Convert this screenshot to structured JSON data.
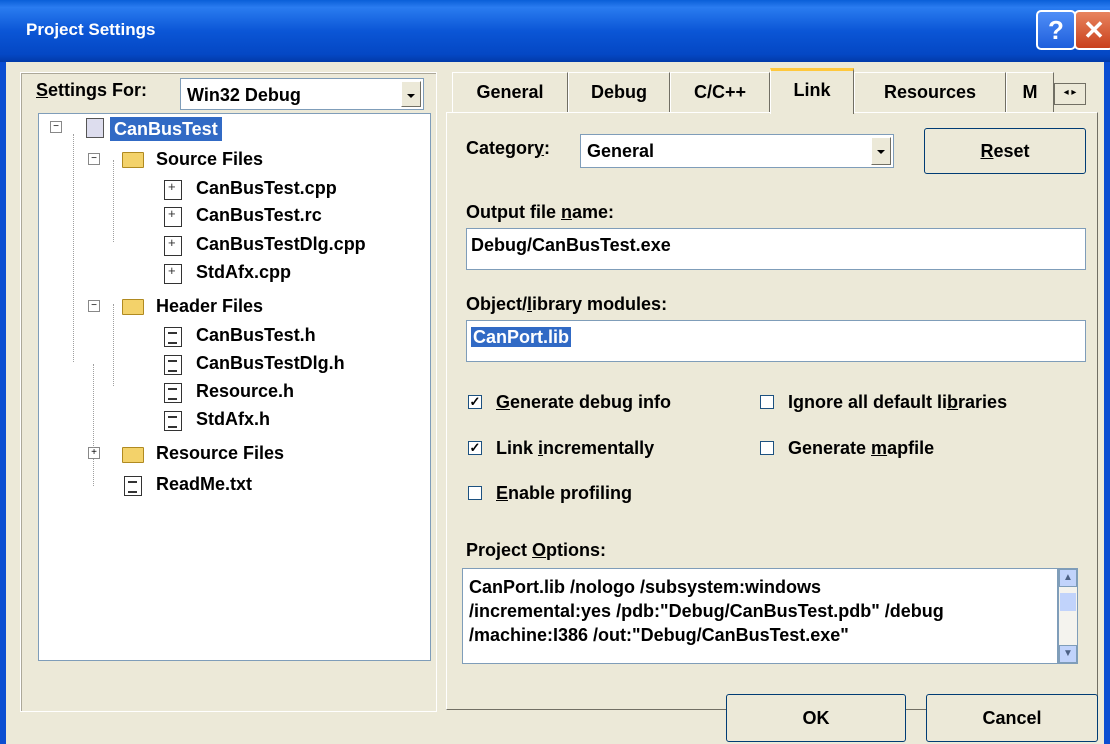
{
  "window": {
    "title": "Project Settings"
  },
  "settings_for": {
    "label": "Settings For:",
    "value": "Win32 Debug"
  },
  "tree": [
    {
      "label": "CanBusTest",
      "type": "project"
    },
    {
      "label": "Source Files",
      "type": "folder"
    },
    {
      "label": "CanBusTest.cpp",
      "type": "cpp"
    },
    {
      "label": "CanBusTest.rc",
      "type": "cpp"
    },
    {
      "label": "CanBusTestDlg.cpp",
      "type": "cpp"
    },
    {
      "label": "StdAfx.cpp",
      "type": "cpp"
    },
    {
      "label": "Header Files",
      "type": "folder"
    },
    {
      "label": "CanBusTest.h",
      "type": "h"
    },
    {
      "label": "CanBusTestDlg.h",
      "type": "h"
    },
    {
      "label": "Resource.h",
      "type": "h"
    },
    {
      "label": "StdAfx.h",
      "type": "h"
    },
    {
      "label": "Resource Files",
      "type": "folder"
    },
    {
      "label": "ReadMe.txt",
      "type": "h"
    }
  ],
  "tabs": [
    "General",
    "Debug",
    "C/C++",
    "Link",
    "Resources",
    "M"
  ],
  "active_tab": "Link",
  "link": {
    "category_label": "Category:",
    "category_value": "General",
    "reset_label": "Reset",
    "output_label": "Output file name:",
    "output_value": "Debug/CanBusTest.exe",
    "modules_label": "Object/library modules:",
    "modules_value": "CanPort.lib",
    "checks": {
      "debug_info": {
        "label": "Generate debug info",
        "checked": true
      },
      "ignore_libs": {
        "label": "Ignore all default libraries",
        "checked": false
      },
      "incremental": {
        "label": "Link incrementally",
        "checked": true
      },
      "mapfile": {
        "label": "Generate mapfile",
        "checked": false
      },
      "profiling": {
        "label": "Enable profiling",
        "checked": false
      }
    },
    "options_label": "Project Options:",
    "options_lines": [
      "CanPort.lib /nologo /subsystem:windows",
      "/incremental:yes /pdb:\"Debug/CanBusTest.pdb\" /debug",
      "/machine:I386 /out:\"Debug/CanBusTest.exe\""
    ]
  },
  "buttons": {
    "ok": "OK",
    "cancel": "Cancel"
  }
}
